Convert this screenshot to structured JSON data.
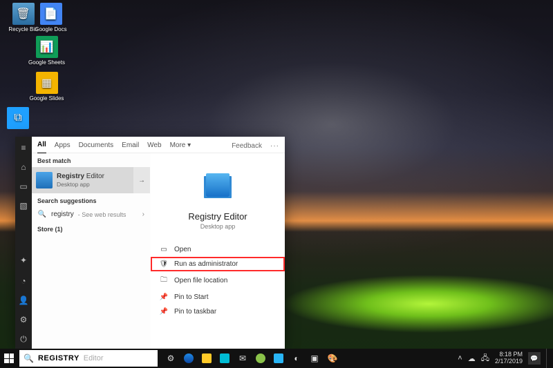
{
  "desktop_icons": {
    "recycle": "Recycle Bin",
    "gdocs": "Google Docs",
    "gsheets": "Google Sheets",
    "gslides": "Google Slides"
  },
  "search_panel": {
    "tabs": {
      "all": "All",
      "apps": "Apps",
      "documents": "Documents",
      "email": "Email",
      "web": "Web",
      "more": "More"
    },
    "feedback": "Feedback",
    "sections": {
      "best_match": "Best match",
      "search_suggestions": "Search suggestions",
      "store": "Store (1)"
    },
    "best_match_item": {
      "title_bold": "Registry",
      "title_rest": " Editor",
      "subtitle": "Desktop app"
    },
    "suggestion": {
      "term": "registry",
      "hint": " - See web results"
    },
    "details": {
      "name": "Registry Editor",
      "kind": "Desktop app"
    },
    "actions": {
      "open": "Open",
      "run_admin": "Run as administrator",
      "open_location": "Open file location",
      "pin_start": "Pin to Start",
      "pin_taskbar": "Pin to taskbar"
    }
  },
  "taskbar": {
    "search_typed": "REGISTRY ",
    "search_ghost": "Editor"
  },
  "tray": {
    "time": "8:18 PM",
    "date": "2/17/2019"
  }
}
